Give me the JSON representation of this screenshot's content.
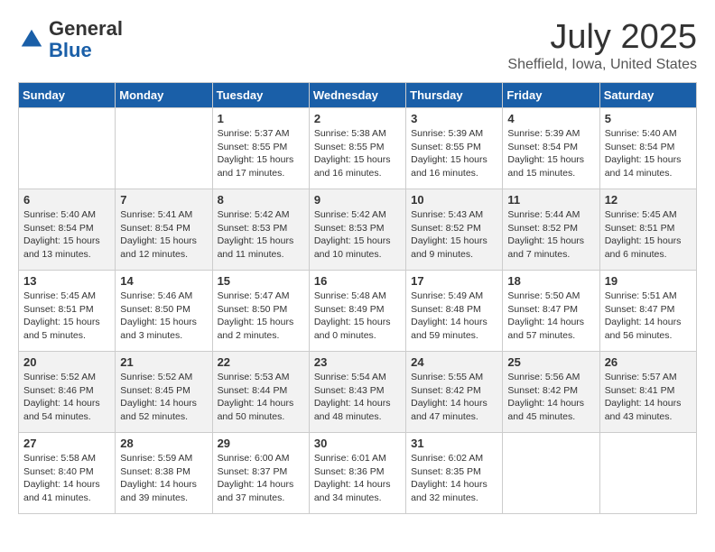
{
  "logo": {
    "general": "General",
    "blue": "Blue"
  },
  "title": "July 2025",
  "location": "Sheffield, Iowa, United States",
  "days_of_week": [
    "Sunday",
    "Monday",
    "Tuesday",
    "Wednesday",
    "Thursday",
    "Friday",
    "Saturday"
  ],
  "weeks": [
    [
      {
        "day": null,
        "sunrise": null,
        "sunset": null,
        "daylight": null
      },
      {
        "day": null,
        "sunrise": null,
        "sunset": null,
        "daylight": null
      },
      {
        "day": "1",
        "sunrise": "Sunrise: 5:37 AM",
        "sunset": "Sunset: 8:55 PM",
        "daylight": "Daylight: 15 hours and 17 minutes."
      },
      {
        "day": "2",
        "sunrise": "Sunrise: 5:38 AM",
        "sunset": "Sunset: 8:55 PM",
        "daylight": "Daylight: 15 hours and 16 minutes."
      },
      {
        "day": "3",
        "sunrise": "Sunrise: 5:39 AM",
        "sunset": "Sunset: 8:55 PM",
        "daylight": "Daylight: 15 hours and 16 minutes."
      },
      {
        "day": "4",
        "sunrise": "Sunrise: 5:39 AM",
        "sunset": "Sunset: 8:54 PM",
        "daylight": "Daylight: 15 hours and 15 minutes."
      },
      {
        "day": "5",
        "sunrise": "Sunrise: 5:40 AM",
        "sunset": "Sunset: 8:54 PM",
        "daylight": "Daylight: 15 hours and 14 minutes."
      }
    ],
    [
      {
        "day": "6",
        "sunrise": "Sunrise: 5:40 AM",
        "sunset": "Sunset: 8:54 PM",
        "daylight": "Daylight: 15 hours and 13 minutes."
      },
      {
        "day": "7",
        "sunrise": "Sunrise: 5:41 AM",
        "sunset": "Sunset: 8:54 PM",
        "daylight": "Daylight: 15 hours and 12 minutes."
      },
      {
        "day": "8",
        "sunrise": "Sunrise: 5:42 AM",
        "sunset": "Sunset: 8:53 PM",
        "daylight": "Daylight: 15 hours and 11 minutes."
      },
      {
        "day": "9",
        "sunrise": "Sunrise: 5:42 AM",
        "sunset": "Sunset: 8:53 PM",
        "daylight": "Daylight: 15 hours and 10 minutes."
      },
      {
        "day": "10",
        "sunrise": "Sunrise: 5:43 AM",
        "sunset": "Sunset: 8:52 PM",
        "daylight": "Daylight: 15 hours and 9 minutes."
      },
      {
        "day": "11",
        "sunrise": "Sunrise: 5:44 AM",
        "sunset": "Sunset: 8:52 PM",
        "daylight": "Daylight: 15 hours and 7 minutes."
      },
      {
        "day": "12",
        "sunrise": "Sunrise: 5:45 AM",
        "sunset": "Sunset: 8:51 PM",
        "daylight": "Daylight: 15 hours and 6 minutes."
      }
    ],
    [
      {
        "day": "13",
        "sunrise": "Sunrise: 5:45 AM",
        "sunset": "Sunset: 8:51 PM",
        "daylight": "Daylight: 15 hours and 5 minutes."
      },
      {
        "day": "14",
        "sunrise": "Sunrise: 5:46 AM",
        "sunset": "Sunset: 8:50 PM",
        "daylight": "Daylight: 15 hours and 3 minutes."
      },
      {
        "day": "15",
        "sunrise": "Sunrise: 5:47 AM",
        "sunset": "Sunset: 8:50 PM",
        "daylight": "Daylight: 15 hours and 2 minutes."
      },
      {
        "day": "16",
        "sunrise": "Sunrise: 5:48 AM",
        "sunset": "Sunset: 8:49 PM",
        "daylight": "Daylight: 15 hours and 0 minutes."
      },
      {
        "day": "17",
        "sunrise": "Sunrise: 5:49 AM",
        "sunset": "Sunset: 8:48 PM",
        "daylight": "Daylight: 14 hours and 59 minutes."
      },
      {
        "day": "18",
        "sunrise": "Sunrise: 5:50 AM",
        "sunset": "Sunset: 8:47 PM",
        "daylight": "Daylight: 14 hours and 57 minutes."
      },
      {
        "day": "19",
        "sunrise": "Sunrise: 5:51 AM",
        "sunset": "Sunset: 8:47 PM",
        "daylight": "Daylight: 14 hours and 56 minutes."
      }
    ],
    [
      {
        "day": "20",
        "sunrise": "Sunrise: 5:52 AM",
        "sunset": "Sunset: 8:46 PM",
        "daylight": "Daylight: 14 hours and 54 minutes."
      },
      {
        "day": "21",
        "sunrise": "Sunrise: 5:52 AM",
        "sunset": "Sunset: 8:45 PM",
        "daylight": "Daylight: 14 hours and 52 minutes."
      },
      {
        "day": "22",
        "sunrise": "Sunrise: 5:53 AM",
        "sunset": "Sunset: 8:44 PM",
        "daylight": "Daylight: 14 hours and 50 minutes."
      },
      {
        "day": "23",
        "sunrise": "Sunrise: 5:54 AM",
        "sunset": "Sunset: 8:43 PM",
        "daylight": "Daylight: 14 hours and 48 minutes."
      },
      {
        "day": "24",
        "sunrise": "Sunrise: 5:55 AM",
        "sunset": "Sunset: 8:42 PM",
        "daylight": "Daylight: 14 hours and 47 minutes."
      },
      {
        "day": "25",
        "sunrise": "Sunrise: 5:56 AM",
        "sunset": "Sunset: 8:42 PM",
        "daylight": "Daylight: 14 hours and 45 minutes."
      },
      {
        "day": "26",
        "sunrise": "Sunrise: 5:57 AM",
        "sunset": "Sunset: 8:41 PM",
        "daylight": "Daylight: 14 hours and 43 minutes."
      }
    ],
    [
      {
        "day": "27",
        "sunrise": "Sunrise: 5:58 AM",
        "sunset": "Sunset: 8:40 PM",
        "daylight": "Daylight: 14 hours and 41 minutes."
      },
      {
        "day": "28",
        "sunrise": "Sunrise: 5:59 AM",
        "sunset": "Sunset: 8:38 PM",
        "daylight": "Daylight: 14 hours and 39 minutes."
      },
      {
        "day": "29",
        "sunrise": "Sunrise: 6:00 AM",
        "sunset": "Sunset: 8:37 PM",
        "daylight": "Daylight: 14 hours and 37 minutes."
      },
      {
        "day": "30",
        "sunrise": "Sunrise: 6:01 AM",
        "sunset": "Sunset: 8:36 PM",
        "daylight": "Daylight: 14 hours and 34 minutes."
      },
      {
        "day": "31",
        "sunrise": "Sunrise: 6:02 AM",
        "sunset": "Sunset: 8:35 PM",
        "daylight": "Daylight: 14 hours and 32 minutes."
      },
      {
        "day": null,
        "sunrise": null,
        "sunset": null,
        "daylight": null
      },
      {
        "day": null,
        "sunrise": null,
        "sunset": null,
        "daylight": null
      }
    ]
  ]
}
